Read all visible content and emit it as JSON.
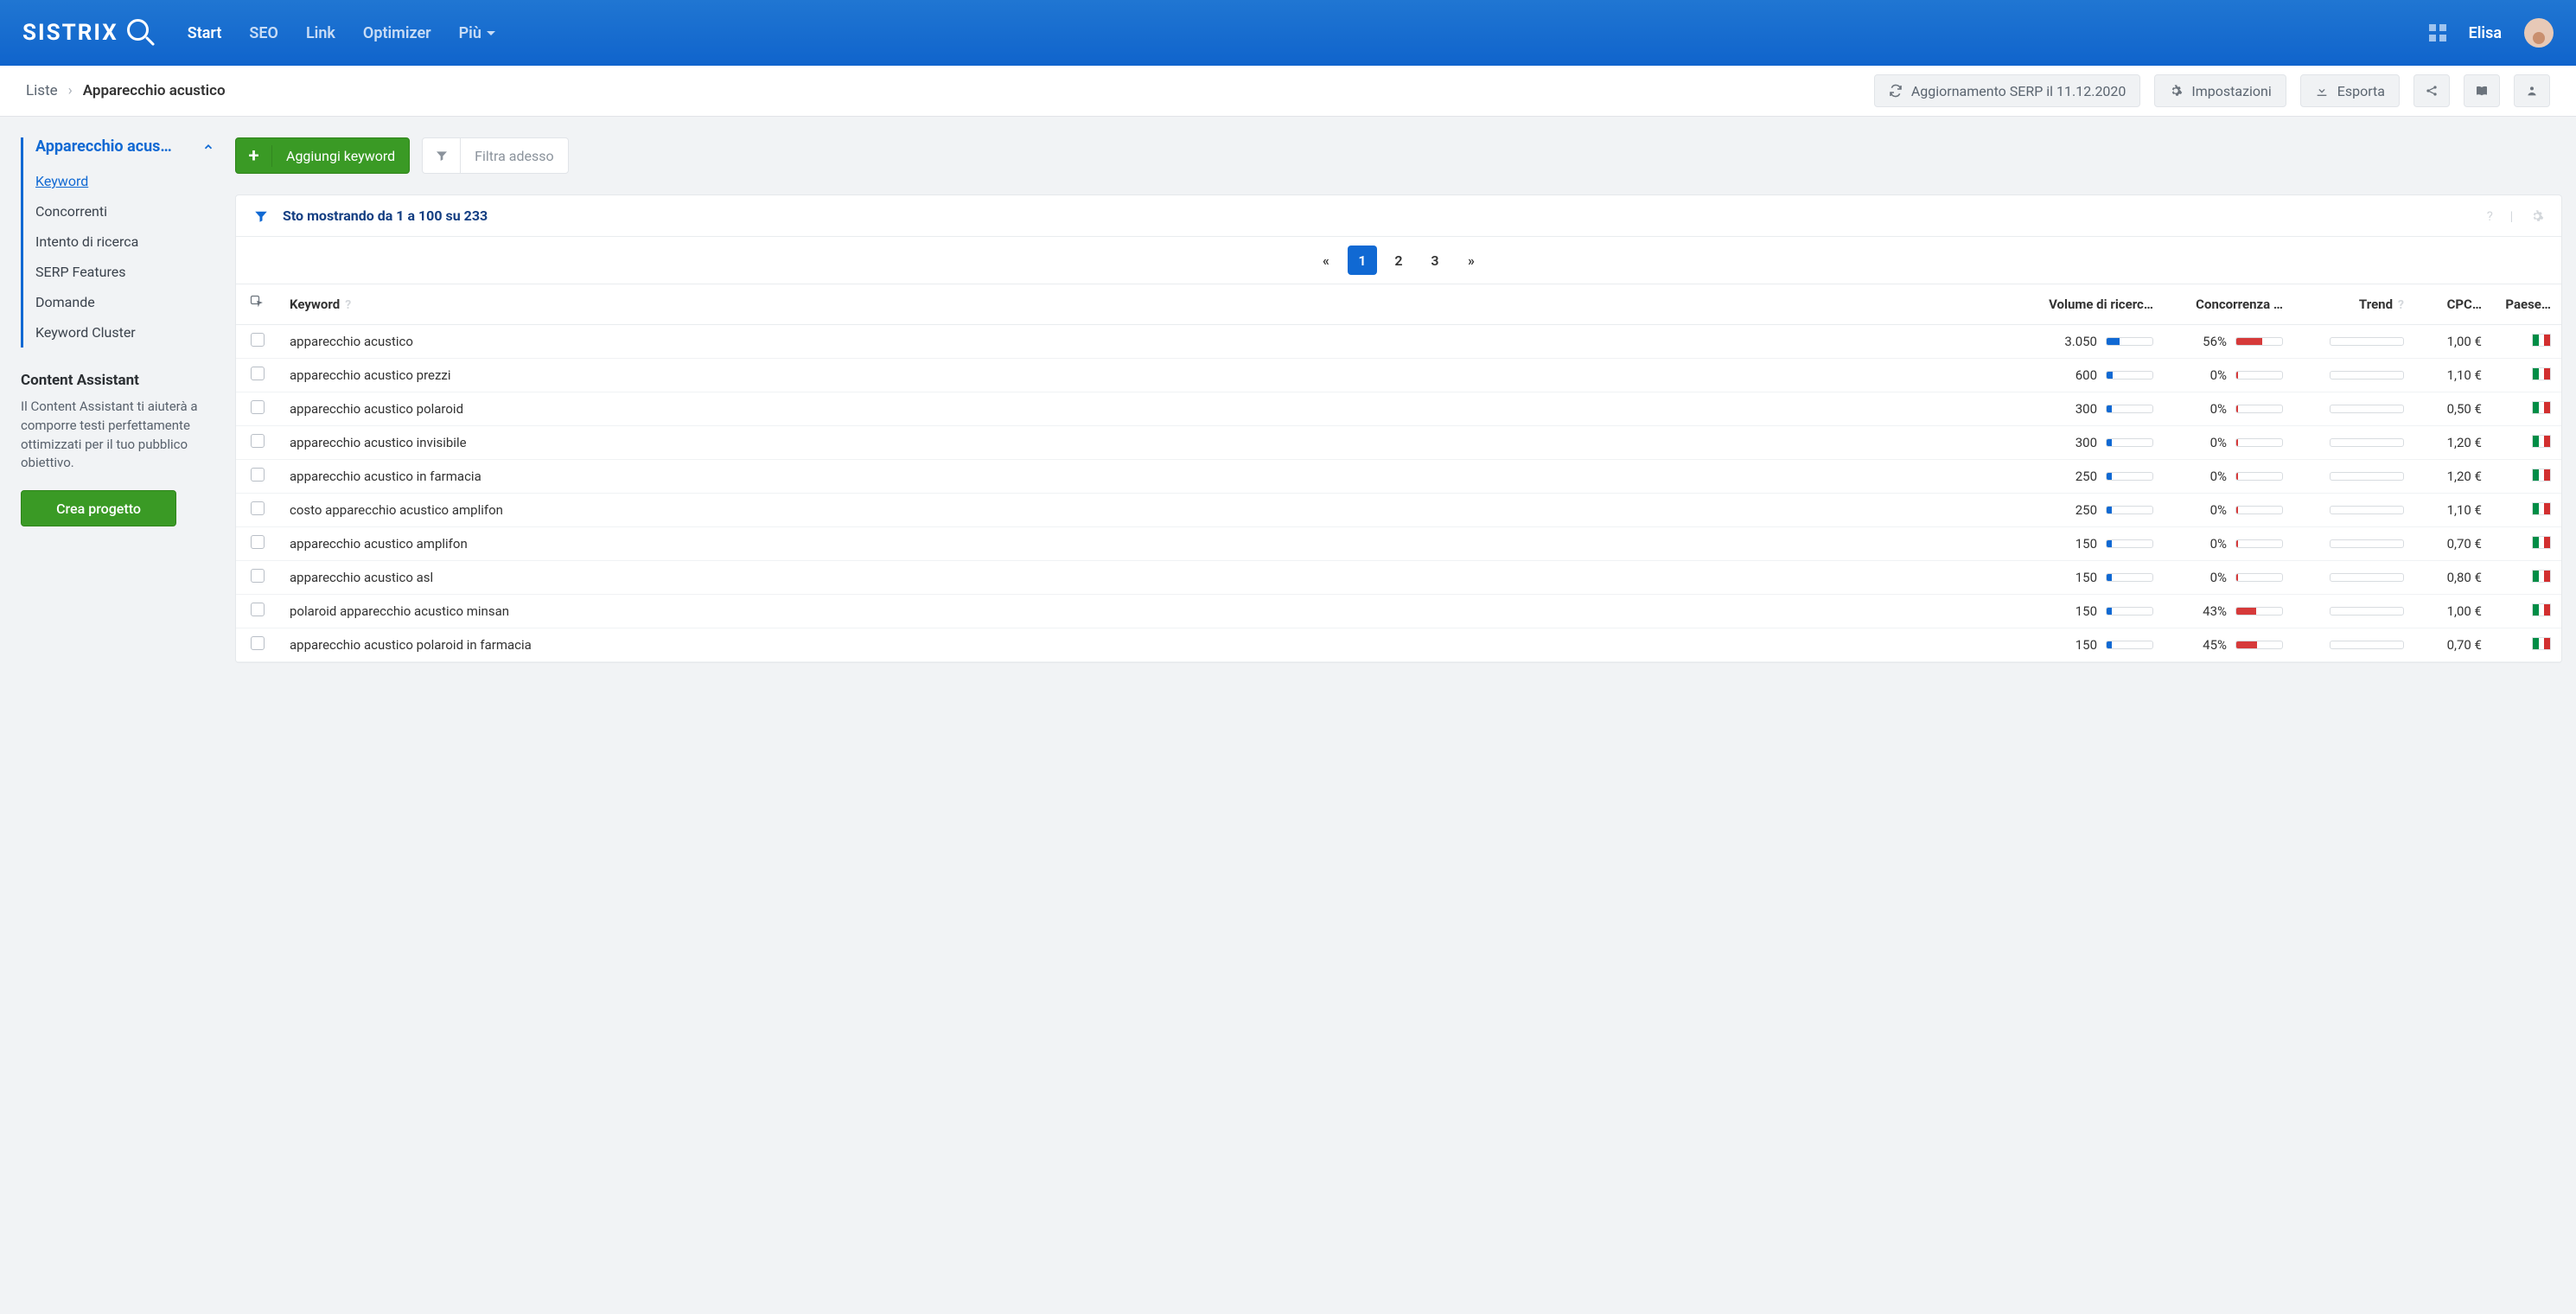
{
  "header": {
    "brand": "SISTRIX",
    "nav": {
      "start": "Start",
      "seo": "SEO",
      "link": "Link",
      "optimizer": "Optimizer",
      "more": "Più"
    },
    "user": "Elisa"
  },
  "sec": {
    "crumb_root": "Liste",
    "crumb_current": "Apparecchio acustico",
    "update": "Aggiornamento SERP il 11.12.2020",
    "settings": "Impostazioni",
    "export": "Esporta"
  },
  "side": {
    "title": "Apparecchio acus…",
    "items": [
      "Keyword",
      "Concorrenti",
      "Intento di ricerca",
      "SERP Features",
      "Domande",
      "Keyword Cluster"
    ],
    "assist_title": "Content Assistant",
    "assist_text": "Il Content Assistant ti aiuterà a comporre testi perfettamente ottimizzati per il tuo pubblico obiettivo.",
    "assist_btn": "Crea progetto"
  },
  "actions": {
    "add": "Aggiungi keyword",
    "filter": "Filtra adesso"
  },
  "table": {
    "showing": "Sto mostrando da 1 a 100 su 233",
    "pages": [
      "1",
      "2",
      "3"
    ],
    "cols": {
      "keyword": "Keyword",
      "volume": "Volume di ricerc…",
      "competition": "Concorrenza …",
      "trend": "Trend",
      "cpc": "CPC…",
      "country": "Paese…"
    },
    "rows": [
      {
        "kw": "apparecchio acustico",
        "vol": "3.050",
        "vol_pct": 28,
        "comp": "56%",
        "comp_pct": 56,
        "cpc": "1,00 €"
      },
      {
        "kw": "apparecchio acustico prezzi",
        "vol": "600",
        "vol_pct": 14,
        "comp": "0%",
        "comp_pct": 2,
        "cpc": "1,10 €"
      },
      {
        "kw": "apparecchio acustico polaroid",
        "vol": "300",
        "vol_pct": 12,
        "comp": "0%",
        "comp_pct": 2,
        "cpc": "0,50 €"
      },
      {
        "kw": "apparecchio acustico invisibile",
        "vol": "300",
        "vol_pct": 12,
        "comp": "0%",
        "comp_pct": 2,
        "cpc": "1,20 €"
      },
      {
        "kw": "apparecchio acustico in farmacia",
        "vol": "250",
        "vol_pct": 12,
        "comp": "0%",
        "comp_pct": 2,
        "cpc": "1,20 €"
      },
      {
        "kw": "costo apparecchio acustico amplifon",
        "vol": "250",
        "vol_pct": 12,
        "comp": "0%",
        "comp_pct": 2,
        "cpc": "1,10 €"
      },
      {
        "kw": "apparecchio acustico amplifon",
        "vol": "150",
        "vol_pct": 11,
        "comp": "0%",
        "comp_pct": 2,
        "cpc": "0,70 €"
      },
      {
        "kw": "apparecchio acustico asl",
        "vol": "150",
        "vol_pct": 11,
        "comp": "0%",
        "comp_pct": 2,
        "cpc": "0,80 €"
      },
      {
        "kw": "polaroid apparecchio acustico minsan",
        "vol": "150",
        "vol_pct": 11,
        "comp": "43%",
        "comp_pct": 43,
        "cpc": "1,00 €"
      },
      {
        "kw": "apparecchio acustico polaroid in farmacia",
        "vol": "150",
        "vol_pct": 11,
        "comp": "45%",
        "comp_pct": 45,
        "cpc": "0,70 €"
      }
    ]
  }
}
